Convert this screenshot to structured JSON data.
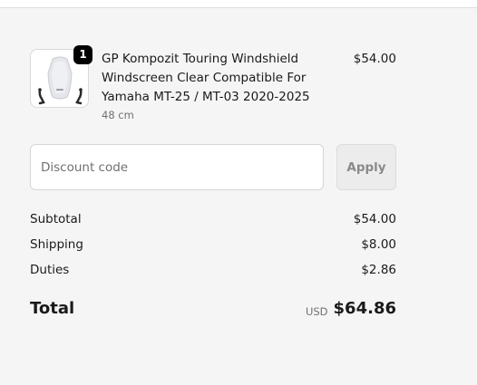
{
  "order": {
    "item": {
      "quantity": "1",
      "title": "GP Kompozit Touring Windshield Windscreen Clear Compatible For Yamaha MT-25 / MT-03 2020-2025",
      "variant": "48 cm",
      "price": "$54.00",
      "image_icon": "windshield-product-image"
    }
  },
  "discount": {
    "placeholder": "Discount code",
    "apply_label": "Apply"
  },
  "summary": {
    "rows": [
      {
        "label": "Subtotal",
        "value": "$54.00"
      },
      {
        "label": "Shipping",
        "value": "$8.00"
      },
      {
        "label": "Duties",
        "value": "$2.86"
      }
    ],
    "total": {
      "label": "Total",
      "currency": "USD",
      "amount": "$64.86"
    }
  },
  "colors": {
    "background": "#f5f5f5",
    "badge": "#000000",
    "apply_disabled_text": "#8a8a8a"
  }
}
